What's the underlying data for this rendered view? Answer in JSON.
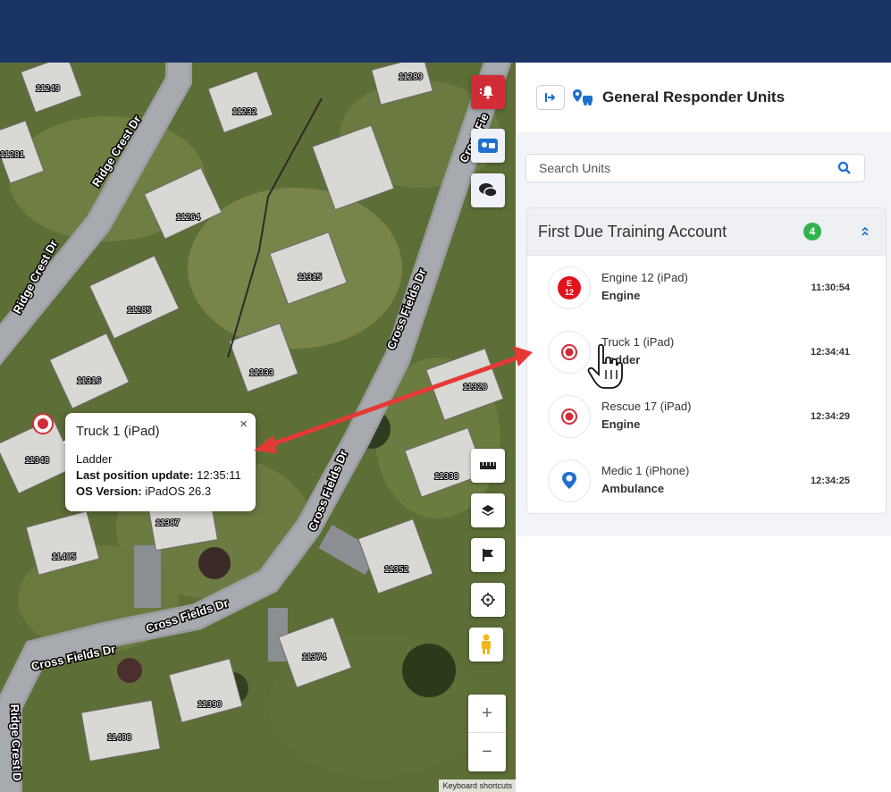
{
  "map": {
    "house_numbers": [
      "11249",
      "11232",
      "11289",
      "11281",
      "11264",
      "11315",
      "11285",
      "11316",
      "11333",
      "11320",
      "11348",
      "11338",
      "11387",
      "11405",
      "11352",
      "11374",
      "11390",
      "11408"
    ],
    "streets": [
      "Ridge Crest Dr",
      "Ridge Crest Dr",
      "Ridge Crest Dr",
      "Cross Fields Dr",
      "Cross Fields Dr",
      "Cross Fields Dr",
      "Cross Fields Dr",
      "Ridge Crest D",
      "Cross Fie"
    ],
    "keyboard_shortcuts": "Keyboard shortcuts",
    "zoom_in": "+",
    "zoom_out": "−",
    "popup": {
      "title": "Truck 1 (iPad)",
      "close": "×",
      "type": "Ladder",
      "last_update_label": "Last position update:",
      "last_update_value": "12:35:11",
      "os_label": "OS Version:",
      "os_value": "iPadOS 26.3"
    },
    "accent_red": "#d22d36"
  },
  "panel": {
    "title": "General Responder Units",
    "search_placeholder": "Search Units",
    "account": {
      "name": "First Due Training Account",
      "count": "4",
      "units": [
        {
          "name": "Engine 12 (iPad)",
          "type": "Engine",
          "time": "11:30:54",
          "icon": "engine-12-badge-icon"
        },
        {
          "name": "Truck 1 (iPad)",
          "type": "Ladder",
          "time": "12:34:41",
          "icon": "truck-marker-icon"
        },
        {
          "name": "Rescue 17 (iPad)",
          "type": "Engine",
          "time": "12:34:29",
          "icon": "rescue-marker-icon"
        },
        {
          "name": "Medic 1 (iPhone)",
          "type": "Ambulance",
          "time": "12:34:25",
          "icon": "ambulance-marker-icon"
        }
      ]
    }
  },
  "colors": {
    "topbar": "#1b3466",
    "accent_blue": "#1f6fd0",
    "badge_green": "#30b24f"
  }
}
